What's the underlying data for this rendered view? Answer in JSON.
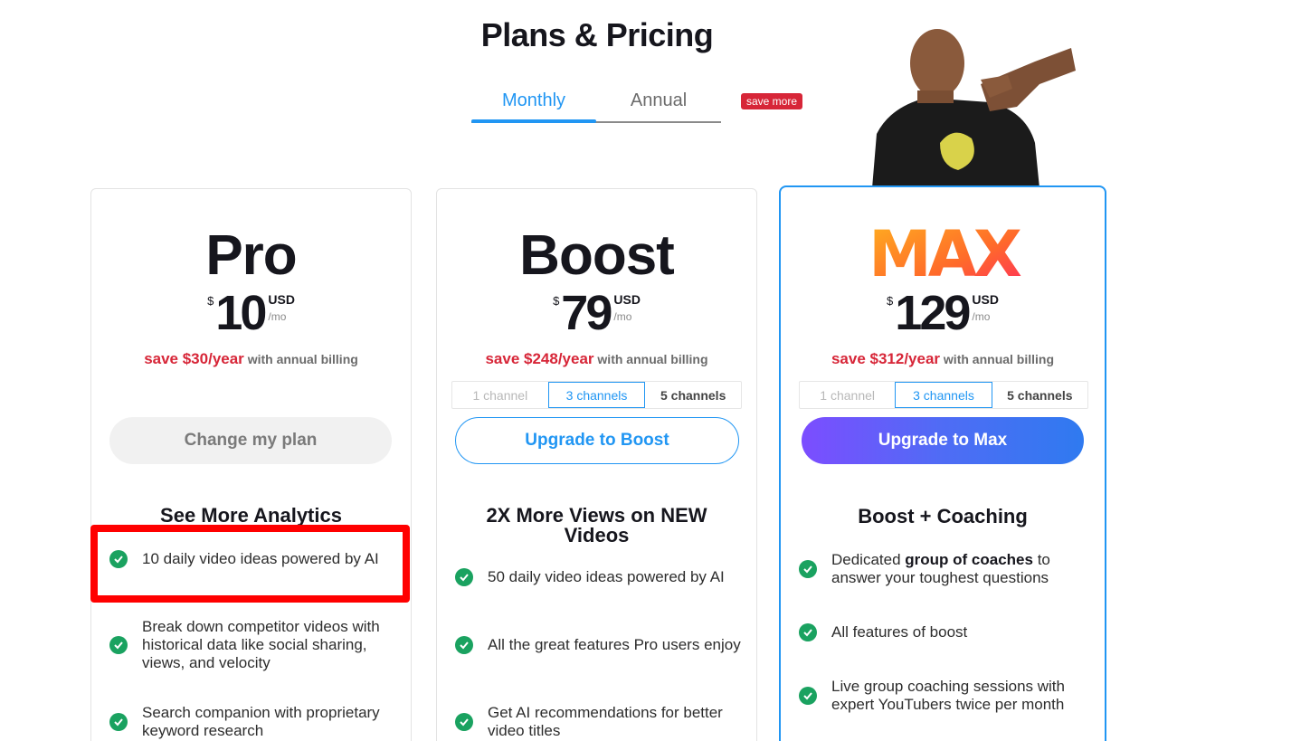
{
  "page": {
    "title": "Plans & Pricing"
  },
  "billing": {
    "tabs": [
      {
        "label": "Monthly",
        "active": true
      },
      {
        "label": "Annual",
        "active": false
      }
    ],
    "badge": "save more"
  },
  "plans": [
    {
      "name": "Pro",
      "currency_symbol": "$",
      "price": "10",
      "currency": "USD",
      "period": "/mo",
      "save_amount": "save $30/year",
      "save_suffix": "with annual billing",
      "cta": "Change my plan",
      "section_title": "See More Analytics",
      "features": [
        "10 daily video ideas powered by AI",
        "Break down competitor videos with historical data like social sharing, views, and velocity",
        "Search companion with proprietary keyword research"
      ]
    },
    {
      "name": "Boost",
      "currency_symbol": "$",
      "price": "79",
      "currency": "USD",
      "period": "/mo",
      "save_amount": "save $248/year",
      "save_suffix": "with annual billing",
      "channels": [
        "1 channel",
        "3 channels",
        "5 channels"
      ],
      "selected_channel": "3 channels",
      "cta": "Upgrade to Boost",
      "section_title": "2X More Views on NEW Videos",
      "features": [
        "50 daily video ideas powered by AI",
        "All the great features Pro users enjoy",
        "Get AI recommendations for better video titles"
      ]
    },
    {
      "name": "MAX",
      "currency_symbol": "$",
      "price": "129",
      "currency": "USD",
      "period": "/mo",
      "save_amount": "save $312/year",
      "save_suffix": "with annual billing",
      "channels": [
        "1 channel",
        "3 channels",
        "5 channels"
      ],
      "selected_channel": "3 channels",
      "cta": "Upgrade to Max",
      "section_title": "Boost + Coaching",
      "features": [
        {
          "pre": "Dedicated ",
          "bold": "group of coaches",
          "post": " to answer your toughest questions"
        },
        "All features of boost",
        "Live group coaching sessions with expert YouTubers twice per month"
      ]
    }
  ],
  "colors": {
    "accent": "#2196f3",
    "save_red": "#d72638",
    "check_green": "#1aa260",
    "highlight": "#ff0000"
  }
}
